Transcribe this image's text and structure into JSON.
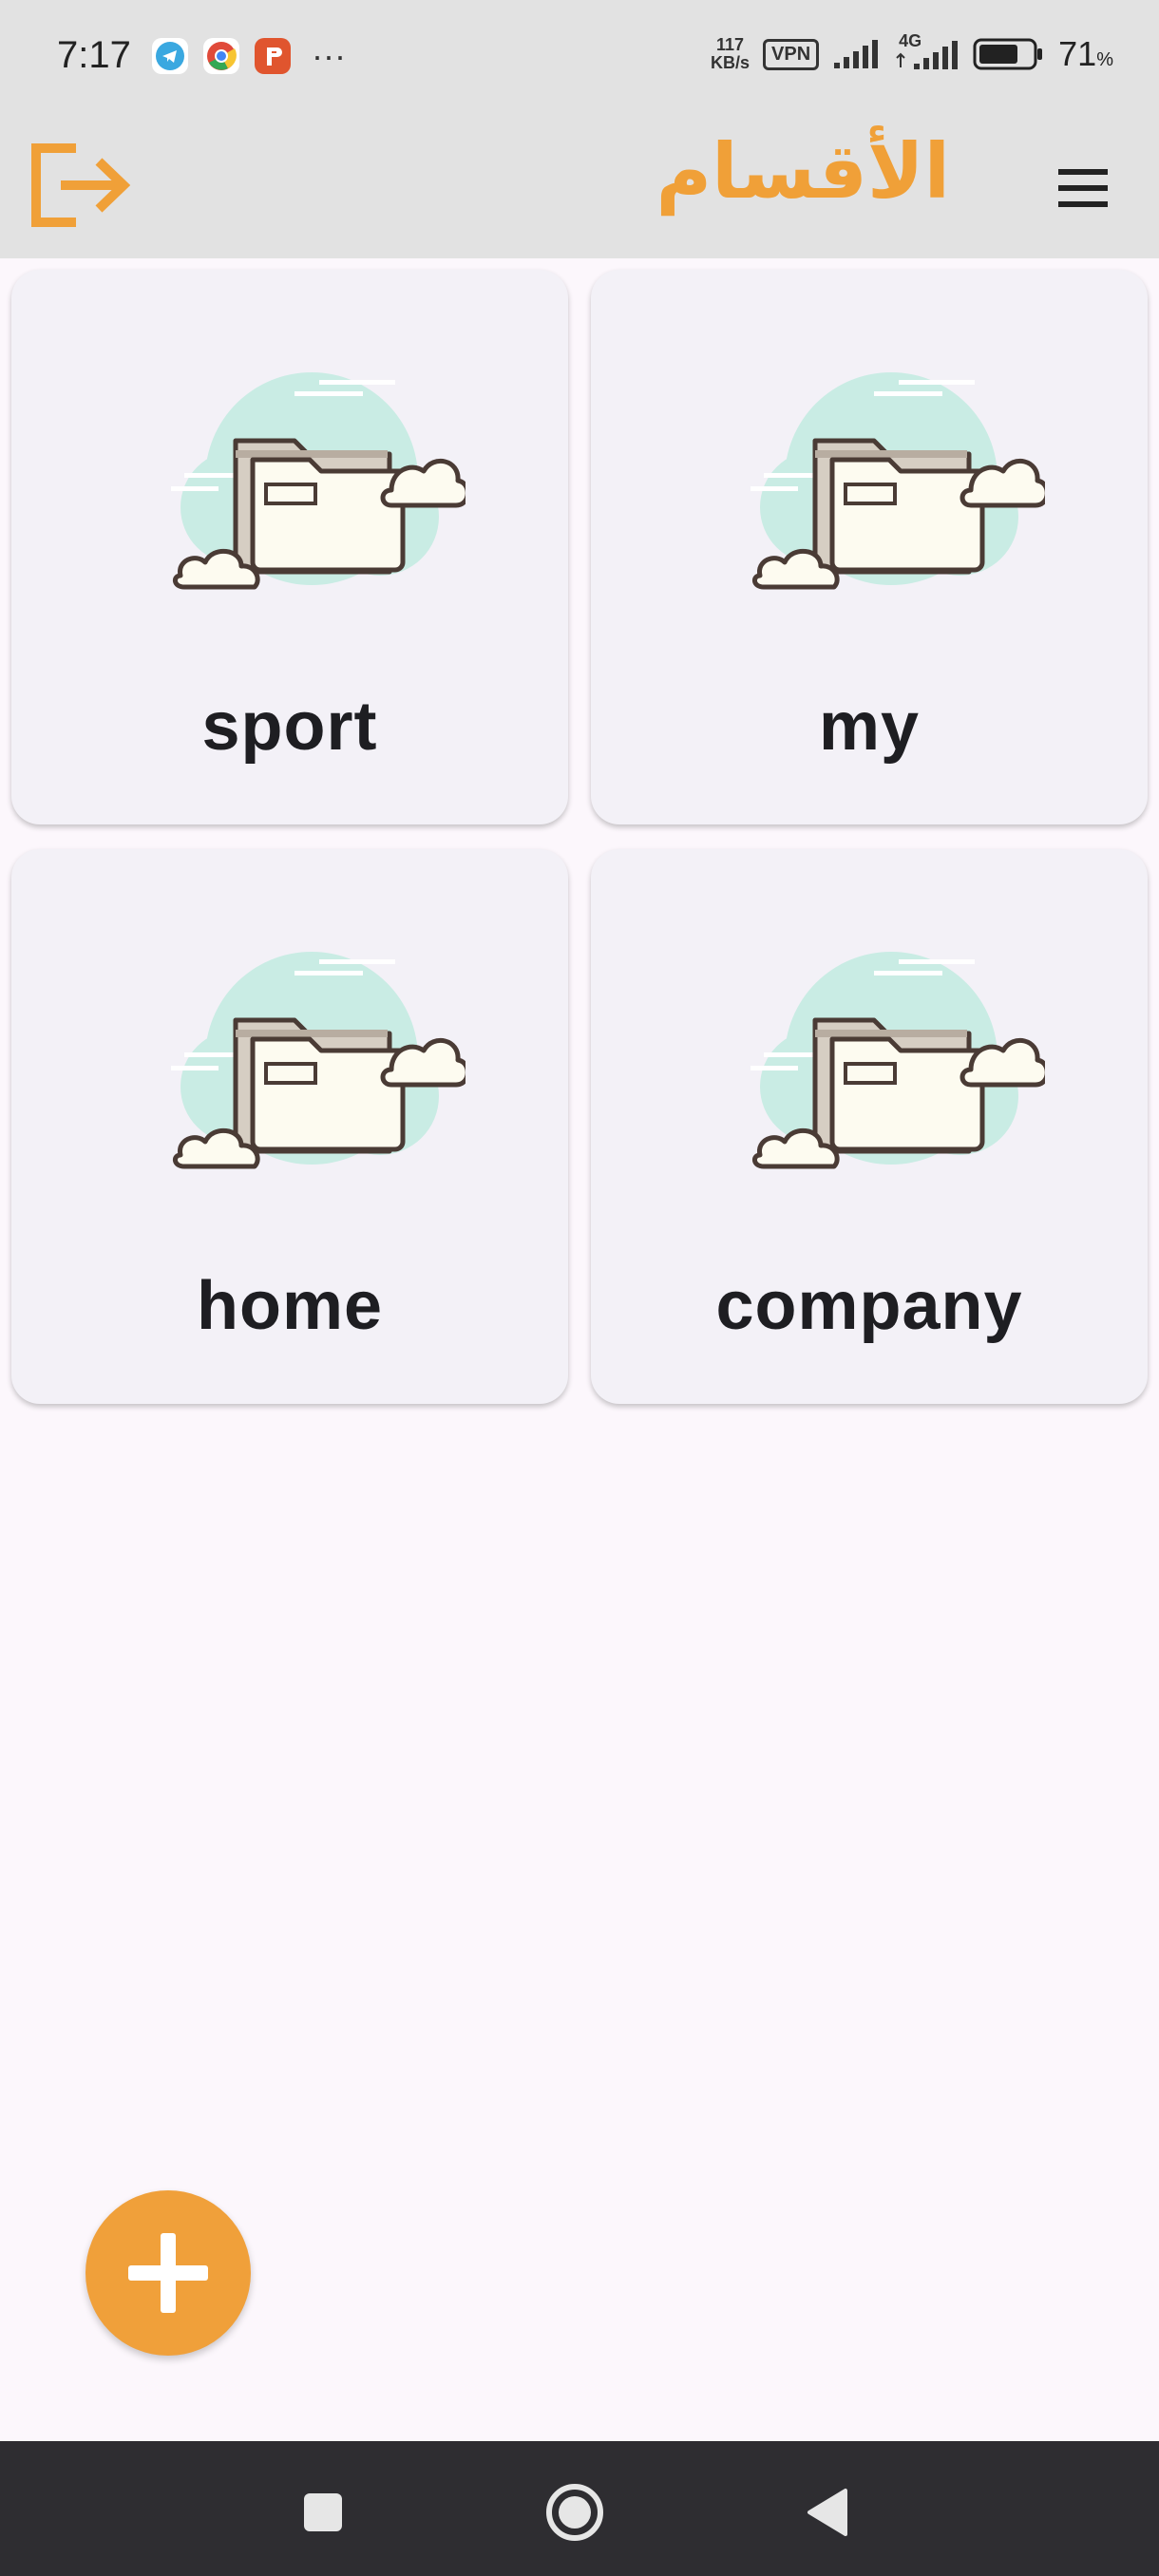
{
  "status_bar": {
    "time": "7:17",
    "network_speed_value": "117",
    "network_speed_unit": "KB/s",
    "vpn_label": "VPN",
    "network_type": "4G",
    "battery_percent": "71",
    "battery_percent_sign": "%",
    "more_indicator": "···",
    "app_icons": [
      "telegram-icon",
      "chrome-icon",
      "psiphon-icon"
    ]
  },
  "app_bar": {
    "title": "الأقسام",
    "title_color": "#f0a038",
    "leading_icon": "logout-icon",
    "trailing_icon": "menu-icon"
  },
  "categories": [
    {
      "name": "sport",
      "icon": "folder-cloud-icon"
    },
    {
      "name": "my",
      "icon": "folder-cloud-icon"
    },
    {
      "name": "home",
      "icon": "folder-cloud-icon"
    },
    {
      "name": "company",
      "icon": "folder-cloud-icon"
    }
  ],
  "fab": {
    "icon": "plus-icon",
    "color": "#f0a03a"
  },
  "nav_bar": {
    "items": [
      "recents-square-icon",
      "home-circle-icon",
      "back-triangle-icon"
    ]
  }
}
